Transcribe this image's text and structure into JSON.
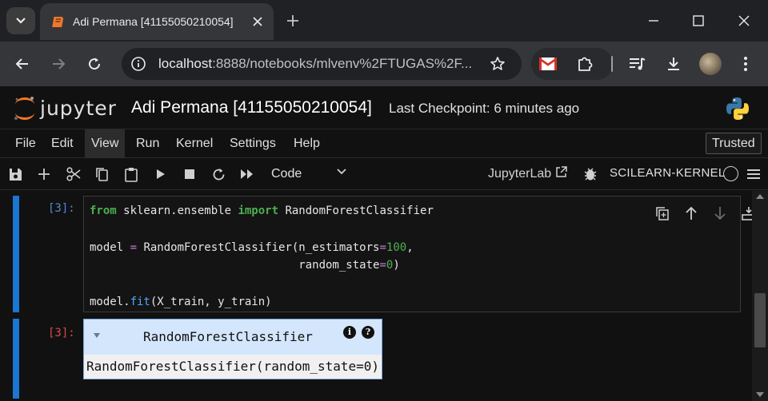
{
  "browser": {
    "tab_title": "Adi Permana [41155050210054]",
    "url_host": "localhost",
    "url_rest": ":8888/notebooks/mlvenv%2FTUGAS%2F..."
  },
  "jupyter": {
    "logo_text": "jupyter",
    "notebook_name": "Adi Permana [41155050210054]",
    "checkpoint": "Last Checkpoint: 6 minutes ago",
    "menu": [
      "File",
      "Edit",
      "View",
      "Run",
      "Kernel",
      "Settings",
      "Help"
    ],
    "menu_active": "View",
    "trusted": "Trusted",
    "cell_type": "Code",
    "jupyterlab_link": "JupyterLab",
    "kernel_name": "SCILEARN-KERNEL"
  },
  "cells": [
    {
      "prompt": "[3]:",
      "code": [
        "from sklearn.ensemble import RandomForestClassifier",
        "",
        "model = RandomForestClassifier(n_estimators=100,",
        "                               random_state=0)",
        "",
        "model.fit(X_train, y_train)"
      ],
      "output_prompt": "[3]:",
      "output_title": "RandomForestClassifier",
      "output_repr": "RandomForestClassifier(random_state=0)",
      "info_glyph": "i",
      "help_glyph": "?"
    }
  ],
  "colors": {
    "collapser": "#1976d2",
    "keyword": "#4caf50",
    "operator": "#c678dd",
    "function": "#4ea8ff",
    "output_header": "#d3e6fb"
  }
}
